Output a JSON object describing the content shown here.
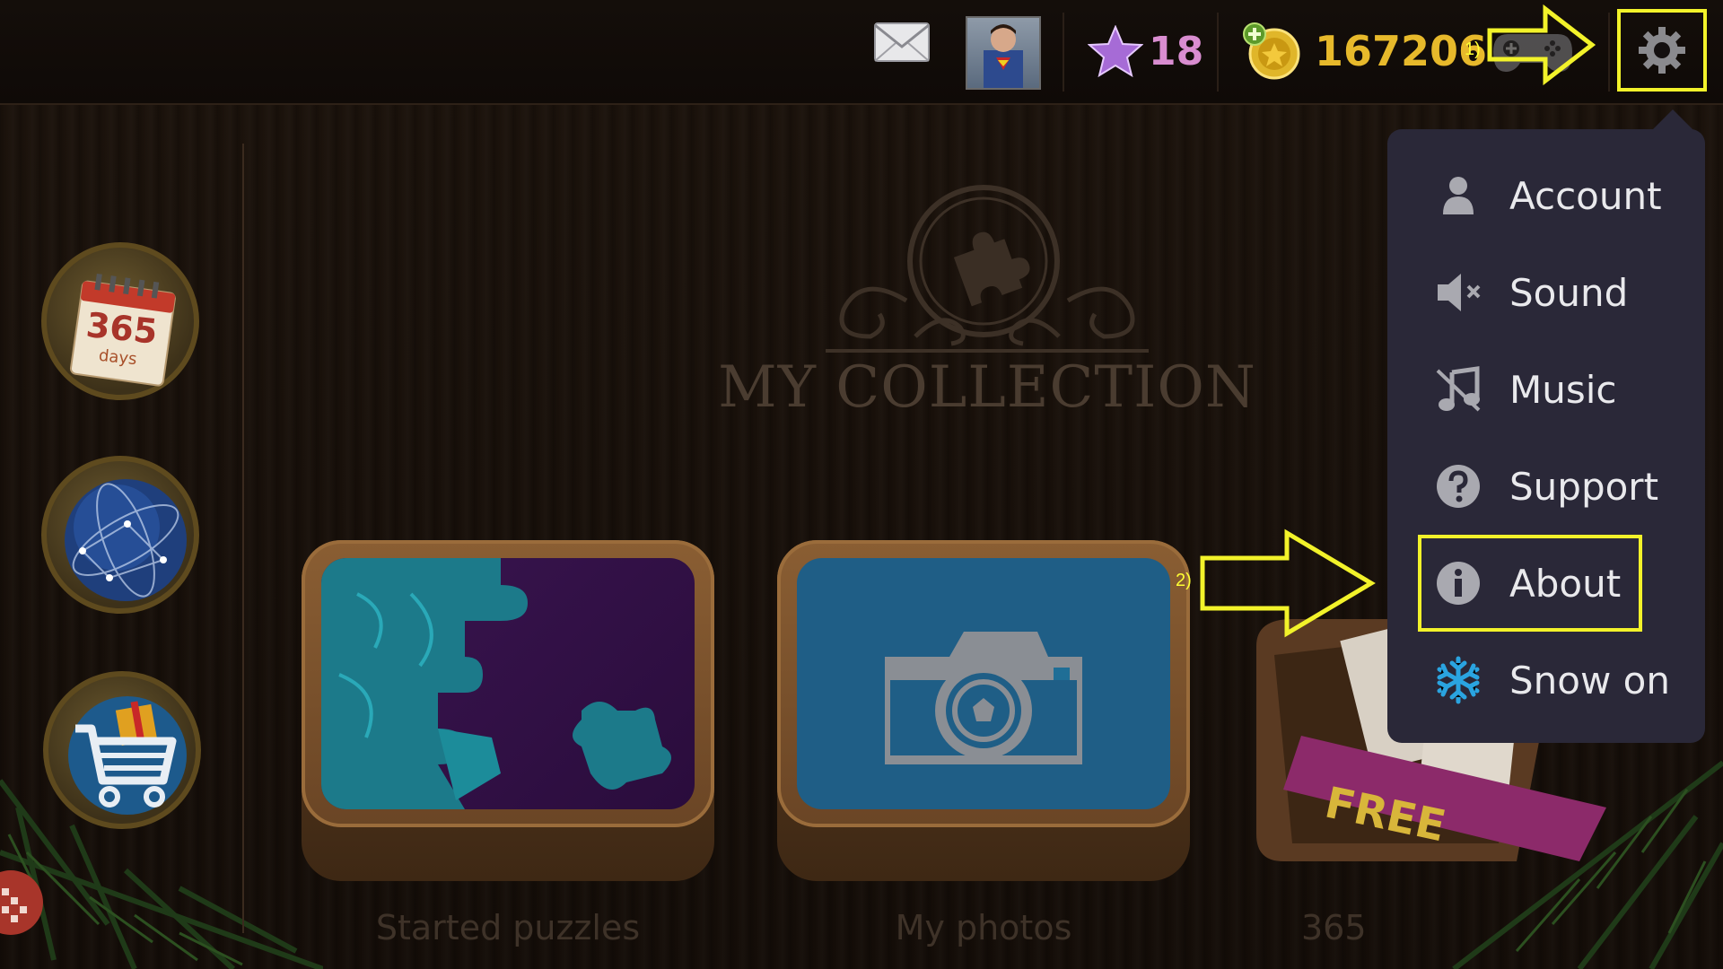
{
  "topbar": {
    "stars": "18",
    "coins": "167206",
    "step1_label": "1)",
    "step2_label": "2)"
  },
  "icons": {
    "mail": "mail-icon",
    "avatar": "avatar",
    "star": "star-icon",
    "coin": "coin-icon",
    "gamepad": "gamepad-icon",
    "settings": "gear-icon"
  },
  "colors": {
    "highlight": "#f2f22a",
    "menu_bg": "#2a2838",
    "coins_text": "#e7b92b",
    "stars_text": "#d98dd0"
  },
  "collection": {
    "title": "MY COLLECTION"
  },
  "left_buttons": {
    "calendar_number": "365",
    "calendar_unit": "days"
  },
  "cards": [
    {
      "label": "Started puzzles"
    },
    {
      "label": "My photos"
    },
    {
      "label": "365",
      "badge": "FREE"
    }
  ],
  "settings_menu": {
    "items": [
      {
        "label": "Account",
        "icon": "user-icon"
      },
      {
        "label": "Sound",
        "icon": "speaker-muted-icon"
      },
      {
        "label": "Music",
        "icon": "music-off-icon"
      },
      {
        "label": "Support",
        "icon": "question-icon"
      },
      {
        "label": "About",
        "icon": "info-icon"
      },
      {
        "label": "Snow on",
        "icon": "snowflake-icon"
      }
    ]
  }
}
